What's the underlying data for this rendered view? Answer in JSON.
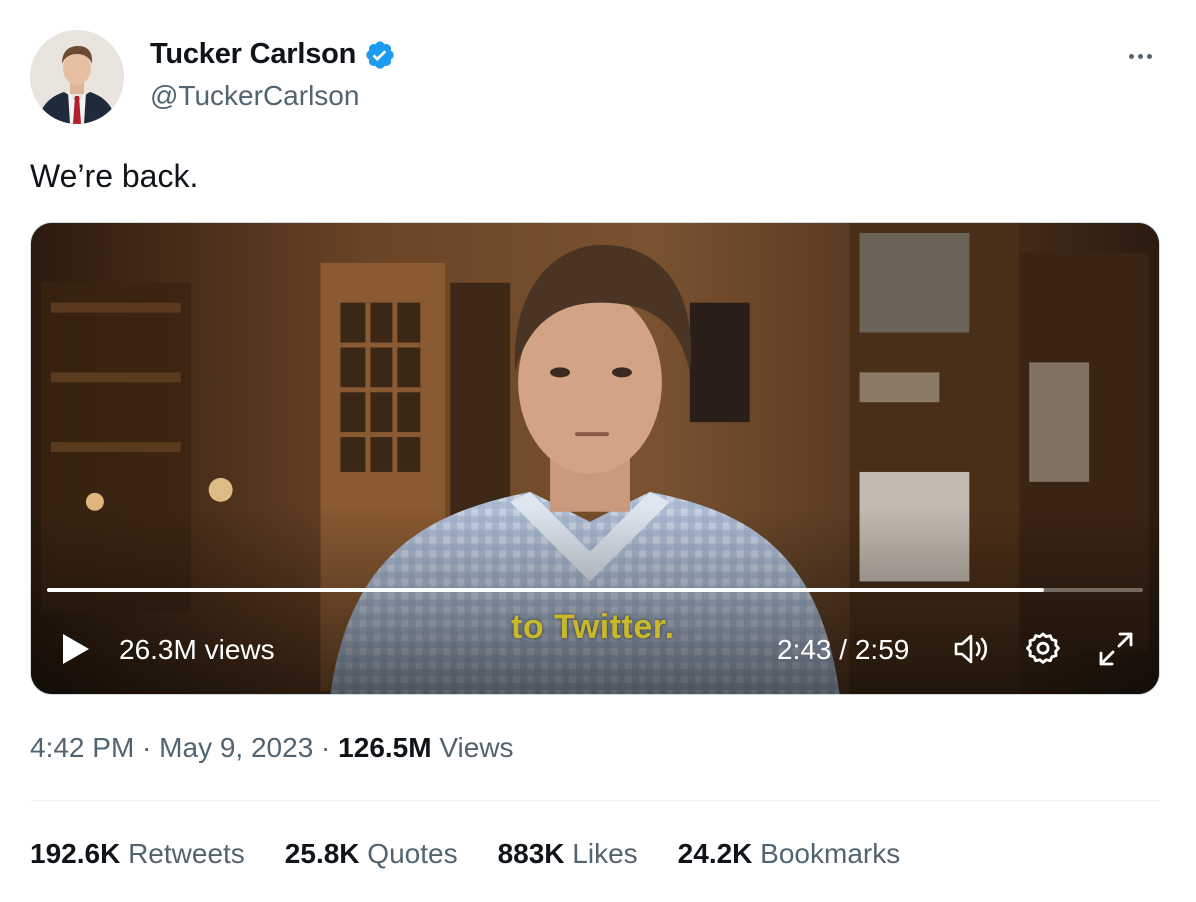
{
  "author": {
    "display_name": "Tucker Carlson",
    "handle": "@TuckerCarlson",
    "verified": true
  },
  "tweet": {
    "text": "We’re back."
  },
  "video": {
    "views": "26.3M views",
    "subtitle": "to Twitter.",
    "current_time": "2:43",
    "separator": " / ",
    "duration": "2:59",
    "progress": 0.91
  },
  "meta": {
    "time": "4:42 PM",
    "dot1": " · ",
    "date": "May 9, 2023",
    "dot2": " · ",
    "views_count": "126.5M",
    "views_label": " Views"
  },
  "stats": [
    {
      "num": "192.6K",
      "label": " Retweets"
    },
    {
      "num": "25.8K",
      "label": " Quotes"
    },
    {
      "num": "883K",
      "label": " Likes"
    },
    {
      "num": "24.2K",
      "label": " Bookmarks"
    }
  ],
  "colors": {
    "verified_blue": "#1d9bf0",
    "secondary_text": "#536471",
    "primary_text": "#0f1419",
    "subtitle_yellow": "#c8b82a"
  },
  "icons": [
    "verified-badge-icon",
    "more-icon",
    "play-icon",
    "volume-icon",
    "settings-icon",
    "fullscreen-icon"
  ]
}
